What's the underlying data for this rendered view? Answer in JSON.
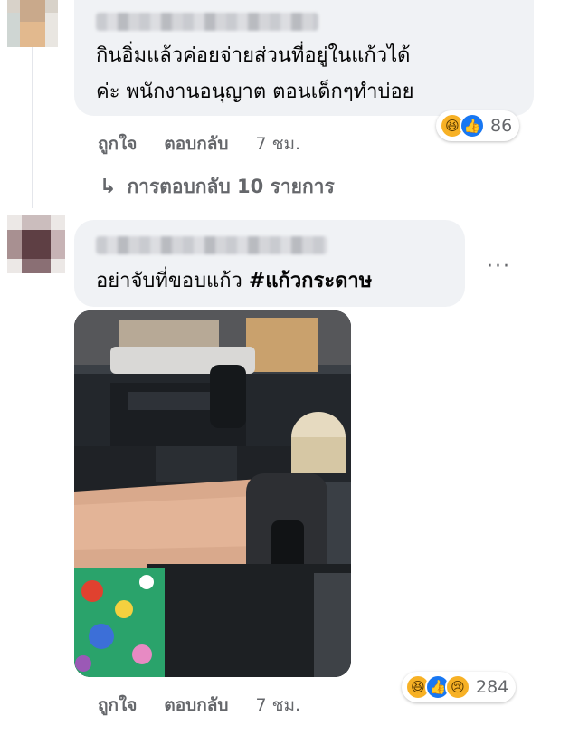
{
  "comments": [
    {
      "text_line1": "กินอิ่มแล้วค่อยจ่ายส่วนที่อยู่ในแก้วได้",
      "text_line2": "ค่ะ พนักงานอนุญาต ตอนเด็กๆทำบ่อย",
      "reactions": {
        "icons": [
          "haha-icon",
          "like-icon"
        ],
        "count": "86"
      },
      "actions": {
        "like": "ถูกใจ",
        "reply": "ตอบกลับ",
        "time": "7 ชม."
      },
      "replies_link": "การตอบกลับ 10 รายการ"
    },
    {
      "text": "อย่าจับที่ขอบแก้ว",
      "hashtag": "#แก้วกระดาษ",
      "more": "···",
      "reactions": {
        "icons": [
          "haha-icon",
          "like-icon",
          "sad-icon"
        ],
        "count": "284"
      },
      "actions": {
        "like": "ถูกใจ",
        "reply": "ตอบกลับ",
        "time": "7 ชม."
      }
    }
  ],
  "colors": {
    "bubble": "#f0f2f5",
    "secondary_text": "#65676b",
    "like_blue": "#1877f2",
    "emoji_yellow": "#f7b125"
  }
}
